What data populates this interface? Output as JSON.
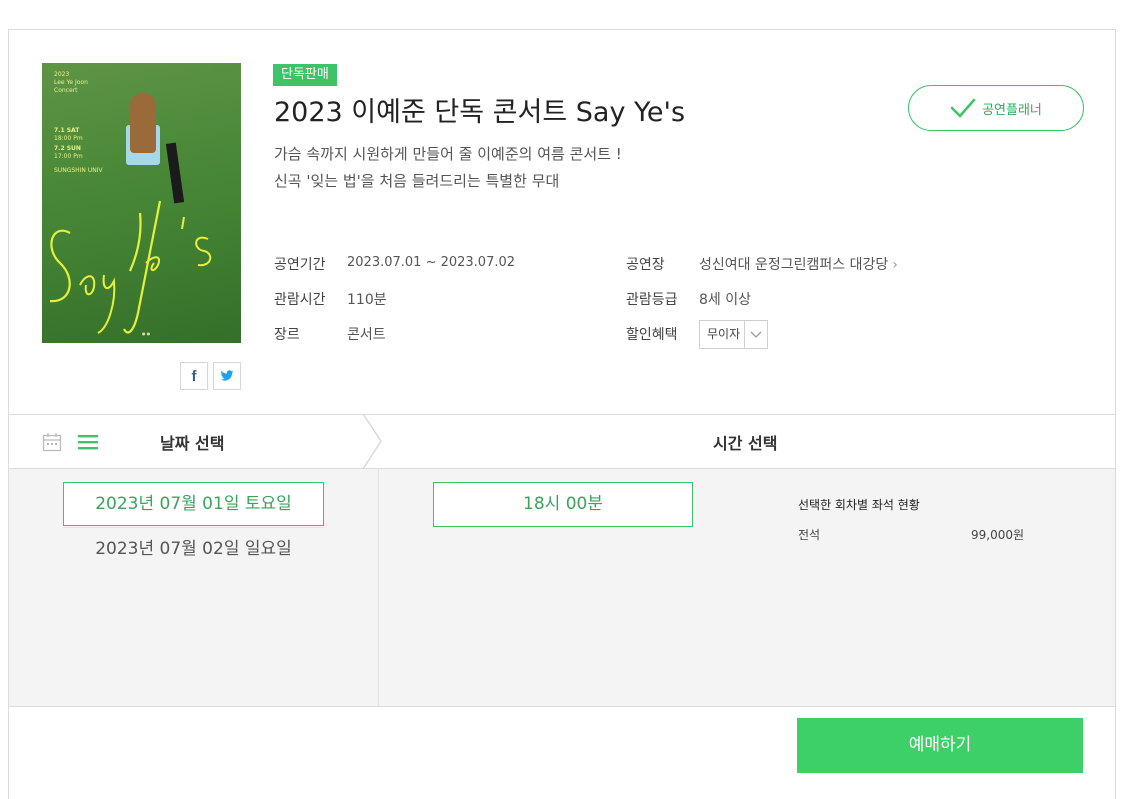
{
  "badge": "단독판매",
  "title": "2023 이예준 단독 콘서트 Say Ye's",
  "description": {
    "line1": "가슴 속까지 시원하게 만들어 줄 이예준의 여름 콘서트 !",
    "line2": "신곡 '잊는 법'을 처음 들려드리는 특별한 무대"
  },
  "planner_button": "공연플래너",
  "poster": {
    "header": "2023",
    "artist": "Lee Ye Joon",
    "concert": "Concert",
    "date1": "7.1 SAT",
    "time1": "18:00 Pm",
    "date2": "7.2 SUN",
    "time2": "17:00 Pm",
    "venue": "SUNGSHIN UNIV",
    "signature": "Say Ye's"
  },
  "info": {
    "period_label": "공연기간",
    "period_value": "2023.07.01 ~ 2023.07.02",
    "venue_label": "공연장",
    "venue_value": "성신여대 운정그린캠퍼스 대강당",
    "runtime_label": "관람시간",
    "runtime_value": "110분",
    "rating_label": "관람등급",
    "rating_value": "8세 이상",
    "genre_label": "장르",
    "genre_value": "콘서트",
    "discount_label": "할인혜택",
    "discount_value": "무이자"
  },
  "share": {
    "facebook": "f",
    "twitter": "t"
  },
  "steps": {
    "date": "날짜 선택",
    "time": "시간 선택"
  },
  "dates": [
    "2023년 07월 01일 토요일",
    "2023년 07월 02일 일요일"
  ],
  "times": [
    "18시 00분"
  ],
  "seat_status": {
    "title": "선택한 회차별 좌석 현황",
    "grade": "전석",
    "price": "99,000원"
  },
  "reserve_button": "예매하기",
  "colors": {
    "accent": "#3ec468",
    "accent_text": "#3aa35d",
    "reserve": "#3ed068"
  }
}
